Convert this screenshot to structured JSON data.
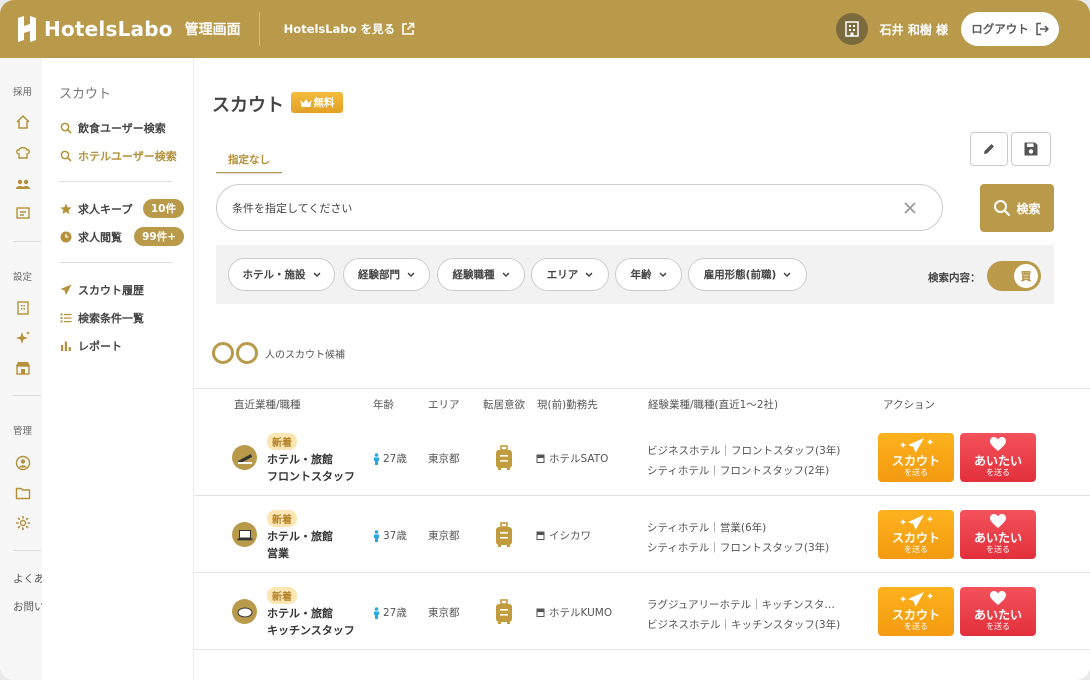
{
  "header": {
    "logo_text": "HotelsLabo",
    "admin_label": "管理画面",
    "view_site_link": "HotelsLabo を見る",
    "user_name": "石井 和樹 様",
    "logout_label": "ログアウト"
  },
  "rail": {
    "section_hire": "採用",
    "section_settings": "設定",
    "section_manage": "管理",
    "faq_text": "よくあ",
    "contact_text": "お問い"
  },
  "sidemenu": {
    "title": "スカウト",
    "items": [
      {
        "label": "飲食ユーザー検索"
      },
      {
        "label": "ホテルユーザー検索"
      },
      {
        "label": "求人キープ",
        "badge": "10件"
      },
      {
        "label": "求人閲覧",
        "badge": "99件+"
      },
      {
        "label": "スカウト履歴"
      },
      {
        "label": "検索条件一覧"
      },
      {
        "label": "レポート"
      }
    ]
  },
  "main": {
    "page_title": "スカウト",
    "free_badge": "無料",
    "tab_label": "指定なし",
    "search_placeholder": "条件を指定してください",
    "search_button": "検索",
    "filters": [
      "ホテル・施設",
      "経験部門",
      "経験職種",
      "エリア",
      "年齢",
      "雇用形態(前職)"
    ],
    "switch_label": "検索内容：",
    "switch_knob": "買",
    "count_text": "人のスカウト候補",
    "columns": [
      "直近業種/職種",
      "年齢",
      "エリア",
      "転居意欲",
      "現(前)勤務先",
      "経験業種/職種(直近1〜2社)",
      "アクション"
    ],
    "rows": [
      {
        "badge": "新着",
        "industry": "ホテル・旅館",
        "job": "フロントスタッフ",
        "age": "27歳",
        "area": "東京都",
        "workplace": "ホテルSATO",
        "exp1": "ビジネスホテル｜フロントスタッフ(3年)",
        "exp2": "シティホテル｜フロントスタッフ(2年)",
        "scout_label": "スカウト",
        "scout_sub": "を送る",
        "aitai_label": "あいたい",
        "aitai_sub": "を送る"
      },
      {
        "badge": "新着",
        "industry": "ホテル・旅館",
        "job": "営業",
        "age": "37歳",
        "area": "東京都",
        "workplace": "イシカワ",
        "exp1": "シティホテル｜営業(6年)",
        "exp2": "シティホテル｜フロントスタッフ(3年)",
        "scout_label": "スカウト",
        "scout_sub": "を送る",
        "aitai_label": "あいたい",
        "aitai_sub": "を送る"
      },
      {
        "badge": "新着",
        "industry": "ホテル・旅館",
        "job": "キッチンスタッフ",
        "age": "27歳",
        "area": "東京都",
        "workplace": "ホテルKUMO",
        "exp1": "ラグジュアリーホテル｜キッチンスタ…",
        "exp2": "ビジネスホテル｜キッチンスタッフ(3年)",
        "scout_label": "スカウト",
        "scout_sub": "を送る",
        "aitai_label": "あいたい",
        "aitai_sub": "を送る"
      }
    ]
  },
  "colors": {
    "brand_gold": "#b99a4b",
    "scout_orange": "#f7a617",
    "aitai_red": "#ec3f49"
  }
}
